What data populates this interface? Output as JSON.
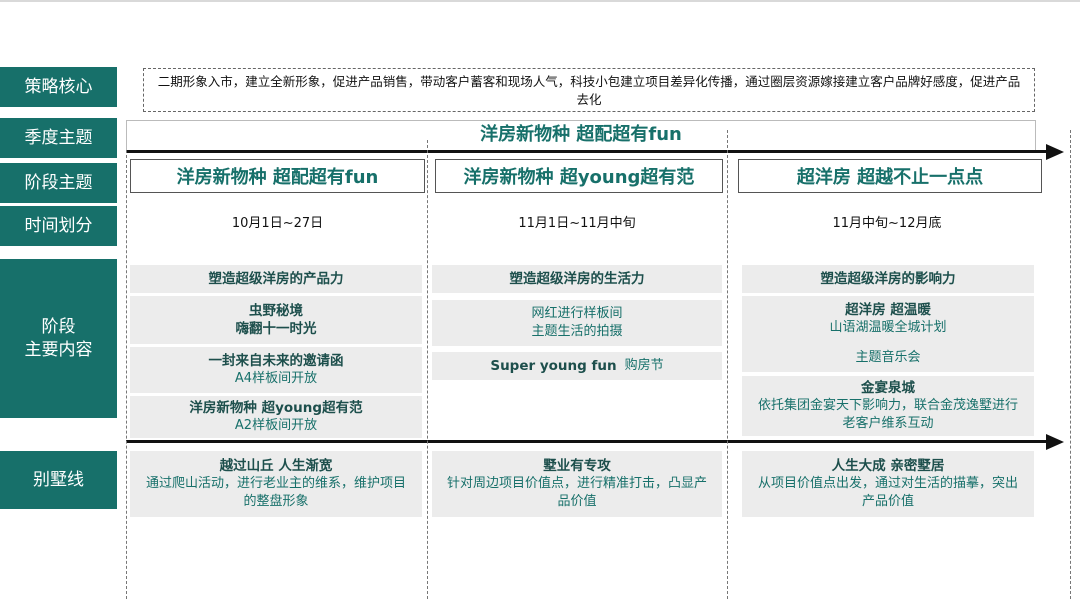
{
  "labels": {
    "strategy": "策略核心",
    "season": "季度主题",
    "stage": "阶段主题",
    "time": "时间划分",
    "content": "阶段\n主要内容",
    "villa": "别墅线"
  },
  "strategy_text": "二期形象入市，建立全新形象，促进产品销售，带动客户蓄客和现场人气，科技小包建立项目差异化传播，通过圈层资源嫁接建立客户品牌好感度，促进产品去化",
  "season_title": "洋房新物种 超配超有fun",
  "stages": [
    {
      "theme": "洋房新物种 超配超有fun",
      "time": "10月1日~27日",
      "header": "塑造超级洋房的产品力",
      "items": [
        {
          "title": "虫野秘境",
          "sub": "嗨翻十一时光"
        },
        {
          "title": "一封来自未来的邀请函",
          "sub": "A4样板间开放"
        },
        {
          "title": "洋房新物种 超young超有范",
          "sub": "A2样板间开放"
        }
      ],
      "villa": {
        "title": "越过山丘 人生渐宽",
        "sub": "通过爬山活动，进行老业主的维系，维护项目的整盘形象"
      }
    },
    {
      "theme": "洋房新物种 超young超有范",
      "time": "11月1日~11月中旬",
      "header": "塑造超级洋房的生活力",
      "items": [
        {
          "title": "",
          "sub": "网红进行样板间\n主题生活的拍摄"
        },
        {
          "title": "Super young fun",
          "sub": "购房节"
        }
      ],
      "villa": {
        "title": "墅业有专攻",
        "sub": "针对周边项目价值点，进行精准打击，凸显产品价值"
      }
    },
    {
      "theme": "超洋房 超越不止一点点",
      "time": "11月中旬~12月底",
      "header": "塑造超级洋房的影响力",
      "items": [
        {
          "title": "超洋房 超温暖",
          "sub": "山语湖温暖全城计划"
        },
        {
          "title": "",
          "sub": "主题音乐会"
        },
        {
          "title": "金宴泉城",
          "sub": "依托集团金宴天下影响力，联合金茂逸墅进行老客户维系互动"
        }
      ],
      "villa": {
        "title": "人生大成 亲密墅居",
        "sub": "从项目价值点出发，通过对生活的描摹，突出产品价值"
      }
    }
  ]
}
